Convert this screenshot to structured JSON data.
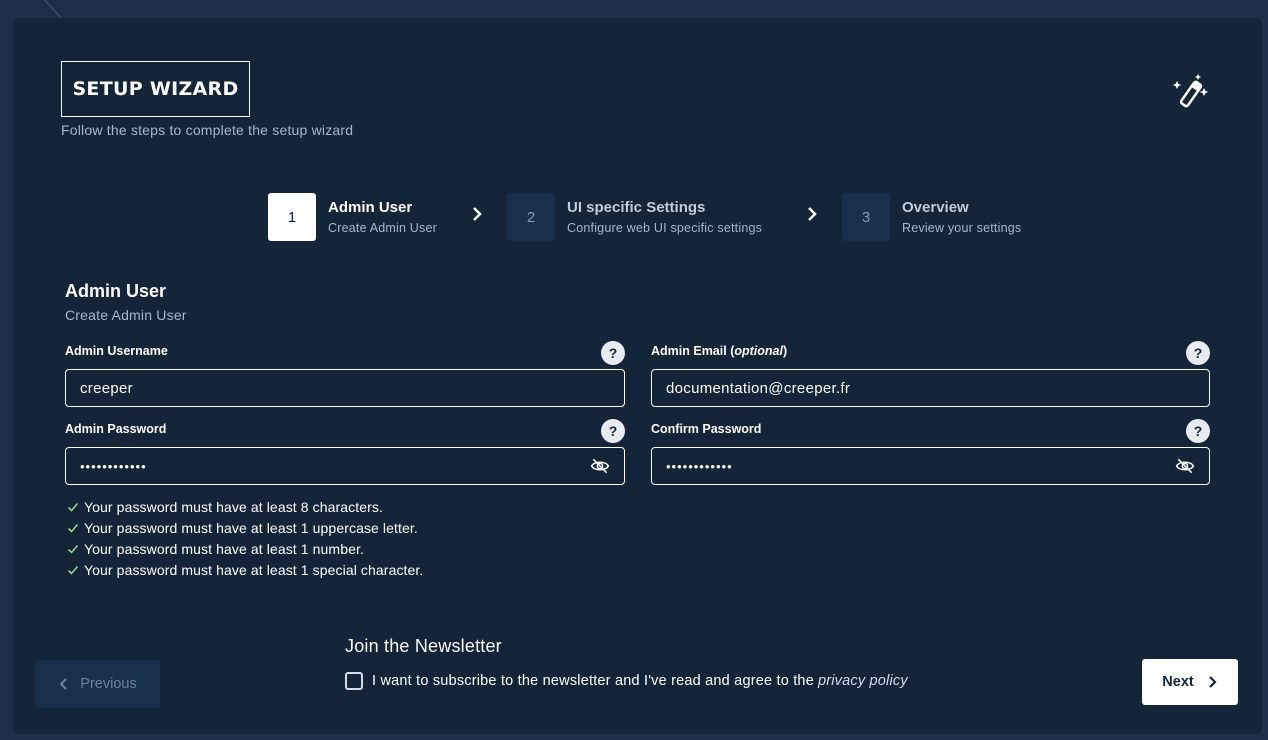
{
  "header": {
    "title": "SETUP WIZARD",
    "subtitle": "Follow the steps to complete the setup wizard",
    "icon": "magic-wand-icon"
  },
  "stepper": {
    "steps": [
      {
        "number": "1",
        "title": "Admin User",
        "description": "Create Admin User",
        "active": true
      },
      {
        "number": "2",
        "title": "UI specific Settings",
        "description": "Configure web UI specific settings",
        "active": false
      },
      {
        "number": "3",
        "title": "Overview",
        "description": "Review your settings",
        "active": false
      }
    ]
  },
  "section": {
    "title": "Admin User",
    "subtitle": "Create Admin User"
  },
  "fields": {
    "username": {
      "label": "Admin Username",
      "value": "creeper",
      "help": "?"
    },
    "email": {
      "label": "Admin Email",
      "label_optional": "optional",
      "value": "documentation@creeper.fr",
      "help": "?"
    },
    "password": {
      "label": "Admin Password",
      "value": "••••••••••••",
      "help": "?"
    },
    "confirm": {
      "label": "Confirm Password",
      "value": "••••••••••••",
      "help": "?"
    }
  },
  "requirements": [
    "Your password must have at least 8 characters.",
    "Your password must have at least 1 uppercase letter.",
    "Your password must have at least 1 number.",
    "Your password must have at least 1 special character."
  ],
  "newsletter": {
    "title": "Join the Newsletter",
    "checkbox_label": "I want to subscribe to the newsletter and I've read and agree to the",
    "link": "privacy policy",
    "checked": false
  },
  "nav": {
    "previous": "Previous",
    "next": "Next"
  },
  "colors": {
    "background": "#1d2e47",
    "card": "#142439",
    "accent": "#ffffff",
    "check": "#8fd68a"
  }
}
